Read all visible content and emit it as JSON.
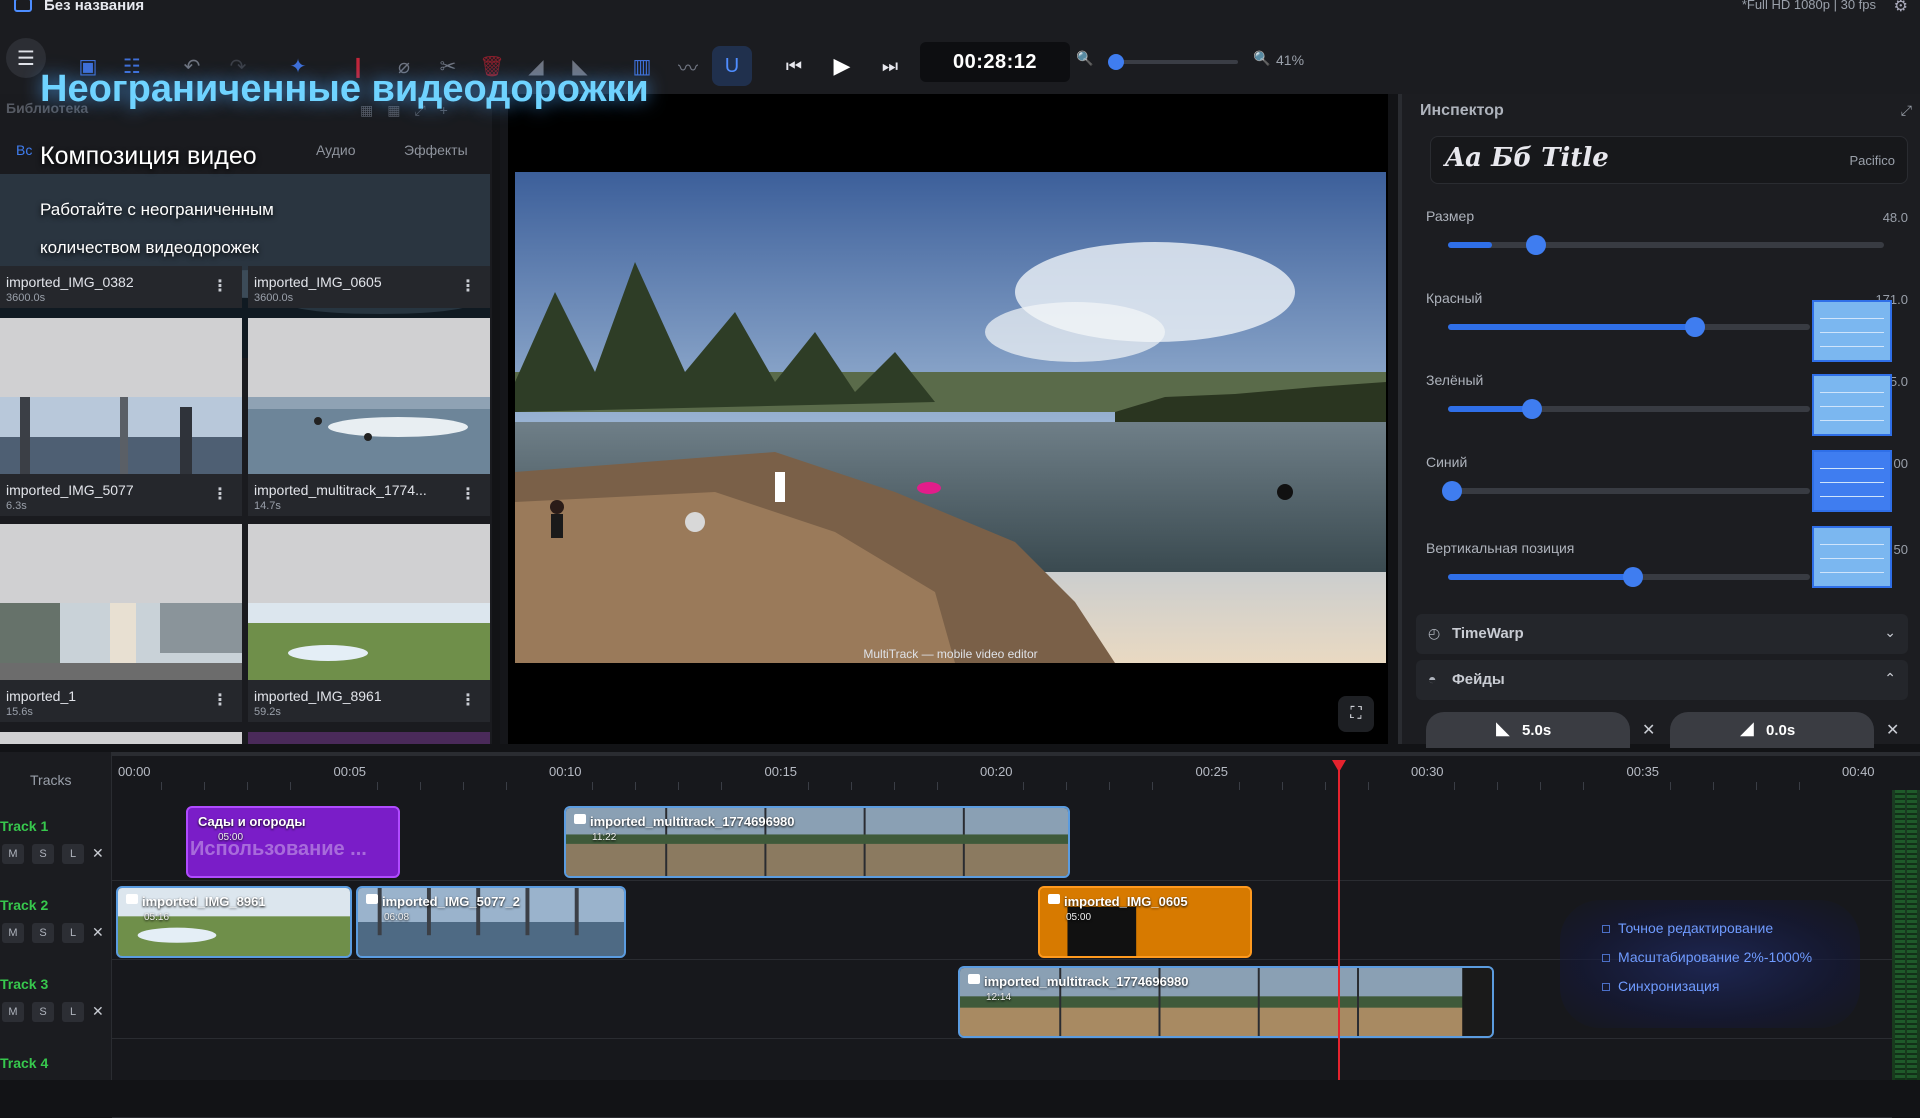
{
  "app": {
    "window_title": "Без названия",
    "project_info": "*Full HD 1080p | 30 fps"
  },
  "toolbar": {
    "timecode": "00:28:12",
    "zoom_percent": "41%",
    "zoom_level": 0.0,
    "icons": [
      "menu-icon",
      "library-icon",
      "adjust-icon",
      "undo-icon",
      "redo-icon",
      "magic-icon",
      "marker-icon",
      "link-icon",
      "scissors-icon",
      "delete-icon",
      "fade-in-icon",
      "fade-out-icon",
      "storyboard-icon",
      "curve-icon",
      "magnet-icon",
      "skip-back-icon",
      "play-icon",
      "skip-forward-icon"
    ]
  },
  "promo": {
    "headline": "Неограниченные видеодорожки",
    "subtitle": "Композиция видео",
    "desc_line1": "Работайте с неограниченным",
    "desc_line2": "количеством видеодорожек",
    "features": [
      "Точное редактирование",
      "Масштабирование 2%-1000%",
      "Синхронизация"
    ]
  },
  "library": {
    "title": "Библиотека",
    "tabs": [
      "Вс",
      "Аудио",
      "Эффекты"
    ],
    "items": [
      {
        "name": "imported_IMG_0382",
        "duration": "3600.0s"
      },
      {
        "name": "imported_IMG_0605",
        "duration": "3600.0s"
      },
      {
        "name": "imported_IMG_5077",
        "duration": "6.3s"
      },
      {
        "name": "imported_multitrack_1774...",
        "duration": "14.7s"
      },
      {
        "name": "imported_1",
        "duration": "15.6s"
      },
      {
        "name": "imported_IMG_8961",
        "duration": "59.2s"
      }
    ]
  },
  "preview": {
    "caption": "MultiTrack — mobile video editor"
  },
  "inspector": {
    "title": "Инспектор",
    "font_preview": "Aa Бб Title",
    "font_name": "Pacifico",
    "sliders": [
      {
        "label": "Размер",
        "value": "48.0",
        "fraction": 0.1
      },
      {
        "label": "Красный",
        "value": "171.0",
        "fraction": 0.67
      },
      {
        "label": "Зелёный",
        "value": "55.0",
        "fraction": 0.22
      },
      {
        "label": "Синий",
        "value": "00",
        "fraction": 0.0
      },
      {
        "label": "Вертикальная позиция",
        "value": "50",
        "fraction": 0.5
      }
    ],
    "timewarp_label": "TimeWarp",
    "fades_label": "Фейды",
    "fade_in": "5.0s",
    "fade_out": "0.0s",
    "swatch_color": "#7bb7f0"
  },
  "timeline": {
    "tracks_label": "Tracks",
    "ruler": [
      "00:00",
      "00:05",
      "00:10",
      "00:15",
      "00:20",
      "00:25",
      "00:30",
      "00:35",
      "00:40"
    ],
    "tracks": [
      {
        "name": "Track 1"
      },
      {
        "name": "Track 2"
      },
      {
        "name": "Track 3"
      },
      {
        "name": "Track 4"
      }
    ],
    "track_buttons": [
      "M",
      "S",
      "L"
    ],
    "clips": [
      {
        "title": "Сады и огороды",
        "duration": "05:00",
        "watermark": "Использование ..."
      },
      {
        "title": "imported_multitrack_1774696980",
        "duration": "11:22"
      },
      {
        "title": "imported_IMG_8961",
        "duration": "05:16"
      },
      {
        "title": "imported_IMG_5077_2",
        "duration": "06:08"
      },
      {
        "title": "imported_IMG_0605",
        "duration": "05:00"
      },
      {
        "title": "imported_multitrack_1774696980",
        "duration": "12:14"
      }
    ],
    "track_color": "#37c84d",
    "playhead_color": "#e5232e"
  }
}
